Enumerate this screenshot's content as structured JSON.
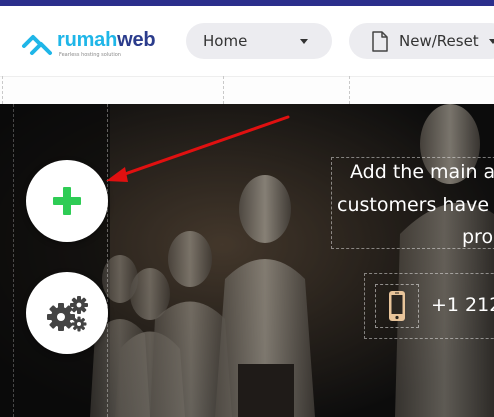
{
  "brand": {
    "name_part1": "rumah",
    "name_part2": "web",
    "tagline": "Fearless hosting solution"
  },
  "toolbar": {
    "home_label": "Home",
    "new_reset_label": "New/Reset"
  },
  "hero": {
    "line1": "Add the main a",
    "line2": "customers have",
    "line3": "pro",
    "phone": "+1 212"
  },
  "icons": {
    "add": "plus-icon",
    "settings": "gears-icon",
    "phone": "mobile-phone-icon",
    "page": "document-icon",
    "dropdown": "caret-down-icon"
  },
  "colors": {
    "top_stripe": "#2b2f8c",
    "logo_primary": "#1fb6e8",
    "logo_secondary": "#2b3c8c",
    "add_icon": "#2ecc55",
    "annotation_arrow": "#e01010",
    "phone_icon": "#e8c49a"
  }
}
